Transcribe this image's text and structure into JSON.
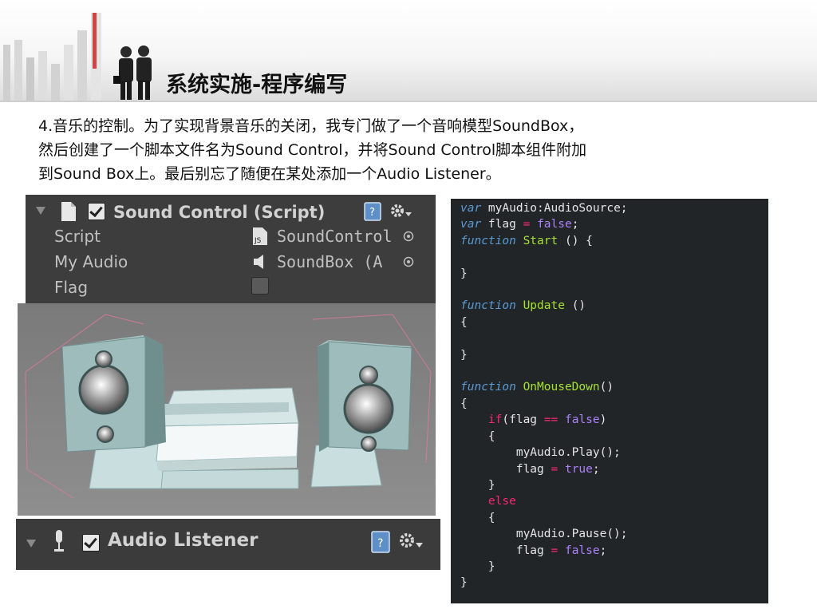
{
  "header": {
    "title": "系统实施-程序编写"
  },
  "paragraph": {
    "line1": "4.音乐的控制。为了实现背景音乐的关闭，我专门做了一个音响模型SoundBox，",
    "line2": "然后创建了一个脚本文件名为Sound Control，并将Sound Control脚本组件附加",
    "line3": "到Sound Box上。最后别忘了随便在某处添加一个Audio Listener。"
  },
  "sound_control_panel": {
    "title": "Sound Control (Script)",
    "fields": [
      {
        "label": "Script",
        "value": "SoundControl",
        "icon": "js-file-icon"
      },
      {
        "label": "My Audio",
        "value": "SoundBox (A",
        "icon": "speaker-icon"
      },
      {
        "label": "Flag",
        "value": ""
      }
    ],
    "enabled": true
  },
  "audio_listener_panel": {
    "title": "Audio Listener",
    "enabled": true
  },
  "code": {
    "lines": [
      "var myAudio:AudioSource;",
      "var flag = false;",
      "function Start () {",
      "",
      "}",
      "",
      "function Update ()",
      "{",
      "",
      "}",
      "",
      "function OnMouseDown()",
      "{",
      "    if(flag == false)",
      "    {",
      "        myAudio.Play();",
      "        flag = true;",
      "    }",
      "    else",
      "    {",
      "        myAudio.Pause();",
      "        flag = false;",
      "    }",
      "}"
    ]
  },
  "colors": {
    "panel_bg": "#3c3c3c",
    "code_bg": "#212527",
    "keyword": "#5b9bd5",
    "function_name": "#a6e22e",
    "control": "#f92672",
    "boolean": "#ae81ff"
  }
}
